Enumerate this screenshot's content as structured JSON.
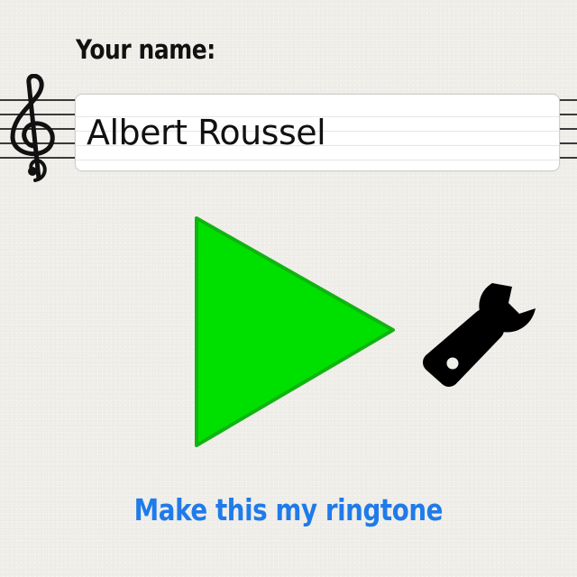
{
  "name_field": {
    "label": "Your name:",
    "value": "Albert Roussel"
  },
  "controls": {
    "play_icon": "play-triangle-icon",
    "play_color": "#00e000",
    "settings_icon": "wrench-icon",
    "clef_icon": "treble-clef-icon"
  },
  "ringtone": {
    "label": "Make this my ringtone",
    "color": "#1f7bea"
  }
}
